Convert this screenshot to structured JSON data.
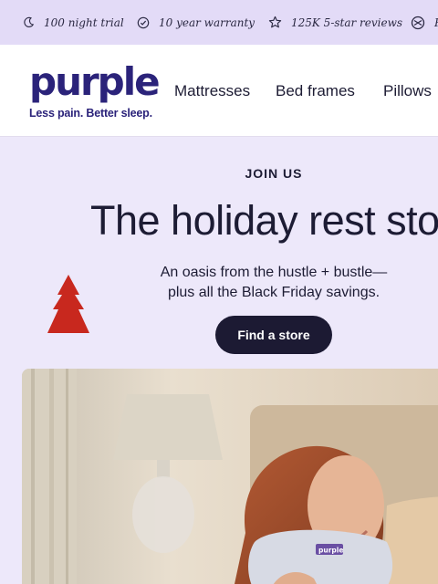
{
  "promo_bar": {
    "items": [
      {
        "label": "100 night trial",
        "icon": "moon-icon"
      },
      {
        "label": "10 year warranty",
        "icon": "check-circle-icon"
      },
      {
        "label": "125K 5-star reviews",
        "icon": "star-icon"
      },
      {
        "label": "F",
        "icon": "smiley-icon"
      }
    ]
  },
  "header": {
    "logo": "purple",
    "tagline": "Less pain. Better sleep.",
    "nav": [
      "Mattresses",
      "Bed frames",
      "Pillows"
    ]
  },
  "hero": {
    "eyebrow": "JOIN US",
    "headline": "The holiday rest stop",
    "subcopy_line1": "An oasis from the hustle + bustle—",
    "subcopy_line2": "plus all the Black Friday savings.",
    "cta_label": "Find a store",
    "pillow_tag": "purple"
  },
  "colors": {
    "brand": "#2b237a",
    "background": "#ede8fa",
    "promo_bar": "#e3dbf7",
    "cta": "#1c1a33",
    "tree": "#c8281e"
  }
}
